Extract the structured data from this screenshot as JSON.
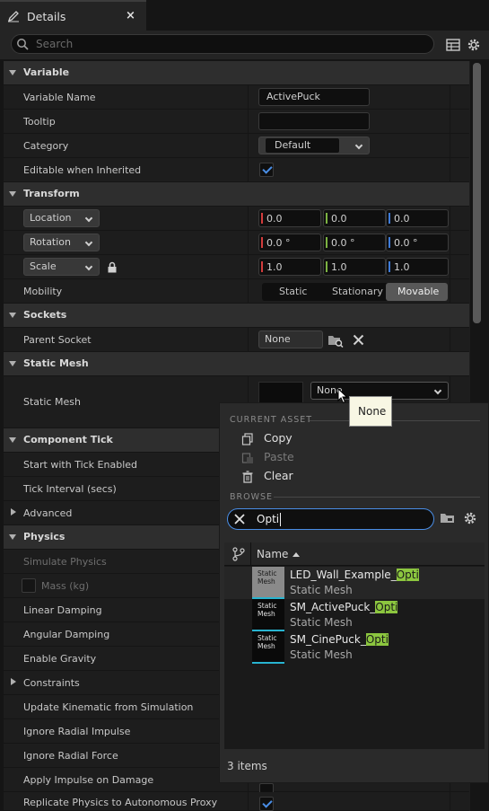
{
  "tab": {
    "title": "Details",
    "close": "×"
  },
  "search": {
    "placeholder": "Search"
  },
  "categories": {
    "variable": "Variable",
    "transform": "Transform",
    "sockets": "Sockets",
    "static_mesh": "Static Mesh",
    "component_tick": "Component Tick",
    "advanced": "Advanced",
    "physics": "Physics",
    "constraints": "Constraints"
  },
  "variable": {
    "name_label": "Variable Name",
    "name_value": "ActivePuck",
    "tooltip_label": "Tooltip",
    "tooltip_value": "",
    "category_label": "Category",
    "category_value": "Default",
    "editable_label": "Editable when Inherited",
    "editable_checked": true
  },
  "transform": {
    "location_label": "Location",
    "location": [
      "0.0",
      "0.0",
      "0.0"
    ],
    "rotation_label": "Rotation",
    "rotation": [
      "0.0 °",
      "0.0 °",
      "0.0 °"
    ],
    "scale_label": "Scale",
    "scale": [
      "1.0",
      "1.0",
      "1.0"
    ],
    "mobility_label": "Mobility",
    "mobility_options": [
      "Static",
      "Stationary",
      "Movable"
    ],
    "mobility_selected": "Movable"
  },
  "sockets": {
    "parent_label": "Parent Socket",
    "parent_value": "None"
  },
  "static_mesh": {
    "label": "Static Mesh",
    "value": "None"
  },
  "tick": {
    "start_label": "Start with Tick Enabled",
    "interval_label": "Tick Interval (secs)"
  },
  "physics": {
    "simulate_label": "Simulate Physics",
    "mass_label": "Mass (kg)",
    "linear_label": "Linear Damping",
    "angular_label": "Angular Damping",
    "gravity_label": "Enable Gravity",
    "kinematic_label": "Update Kinematic from Simulation",
    "radial_impulse_label": "Ignore Radial Impulse",
    "radial_force_label": "Ignore Radial Force",
    "apply_impulse_label": "Apply Impulse on Damage",
    "replicate_label": "Replicate Physics to Autonomous Proxy"
  },
  "tooltip_popup": "None",
  "asset_picker": {
    "current_asset_header": "CURRENT ASSET",
    "copy": "Copy",
    "paste": "Paste",
    "clear": "Clear",
    "browse_header": "BROWSE",
    "search_value": "Opti",
    "column_name": "Name",
    "thumb_label_1": "Static",
    "thumb_label_2": "Mesh",
    "items": [
      {
        "prefix": "LED_Wall_Example_",
        "match": "Opti",
        "type": "Static Mesh"
      },
      {
        "prefix": "SM_ActivePuck_",
        "match": "Opti",
        "type": "Static Mesh"
      },
      {
        "prefix": "SM_CinePuck_",
        "match": "Opti",
        "type": "Static Mesh"
      }
    ],
    "count": "3 items"
  },
  "colors": {
    "accent": "#4a8ee6",
    "highlight": "#8cc63f",
    "x_axis": "#d23c3c",
    "y_axis": "#7cb342",
    "z_axis": "#3d7bd8"
  }
}
